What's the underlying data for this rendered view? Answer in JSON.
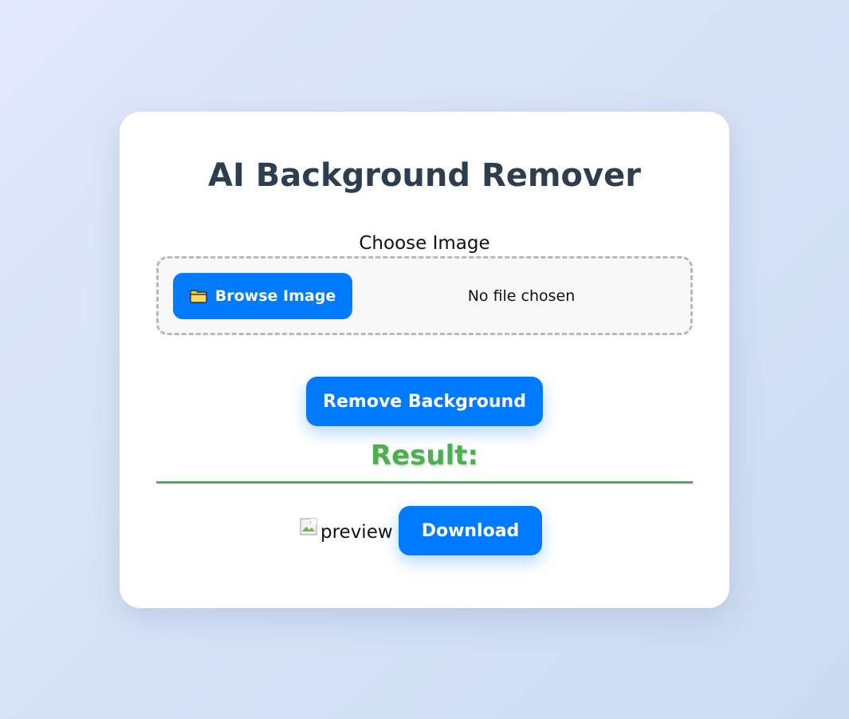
{
  "app": {
    "title": "AI Background Remover"
  },
  "upload": {
    "label": "Choose Image",
    "browse_label": "Browse Image",
    "browse_icon": "folder-icon",
    "file_status": "No file chosen"
  },
  "actions": {
    "remove_label": "Remove Background",
    "download_label": "Download"
  },
  "result": {
    "heading": "Result:",
    "preview_alt": "preview",
    "preview_icon": "broken-image-icon"
  },
  "colors": {
    "accent": "#007bff",
    "result": "#4caf50",
    "title": "#2c3e50"
  }
}
